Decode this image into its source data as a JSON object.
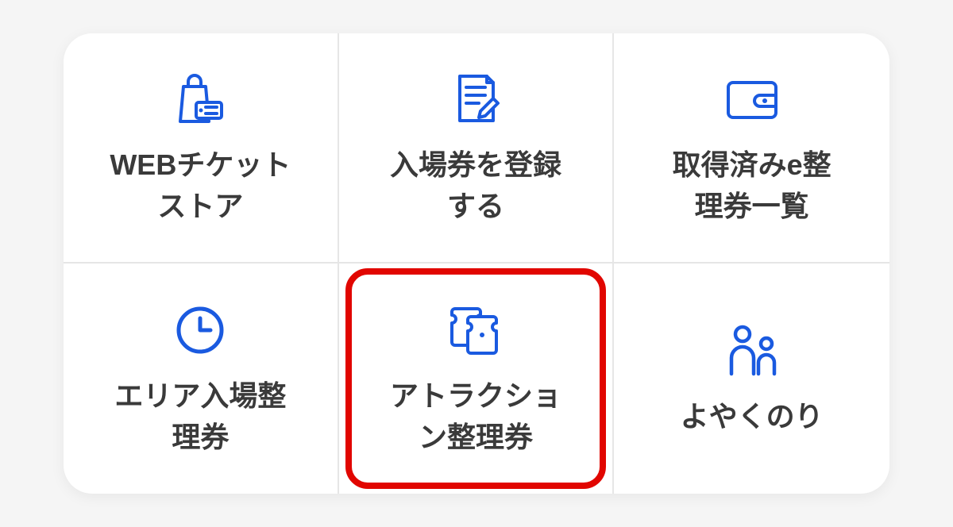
{
  "colors": {
    "primary": "#1a5ae0",
    "text": "#3a3a3a",
    "highlight": "#e10600"
  },
  "menu": {
    "items": [
      {
        "id": "web-ticket-store",
        "label": "WEBチケット<br>ストア",
        "icon": "shopping-bag-ticket-icon",
        "highlighted": false
      },
      {
        "id": "register-ticket",
        "label": "入場券を登録<br>する",
        "icon": "edit-document-icon",
        "highlighted": false
      },
      {
        "id": "obtained-etickets",
        "label": "取得済みe整<br>理券一覧",
        "icon": "wallet-icon",
        "highlighted": false
      },
      {
        "id": "area-entry-ticket",
        "label": "エリア入場整<br>理券",
        "icon": "clock-icon",
        "highlighted": false
      },
      {
        "id": "attraction-ticket",
        "label": "アトラクショ<br>ン整理券",
        "icon": "tickets-icon",
        "highlighted": true
      },
      {
        "id": "yoyaku-nori",
        "label": "よやくのり",
        "icon": "family-icon",
        "highlighted": false
      }
    ]
  }
}
